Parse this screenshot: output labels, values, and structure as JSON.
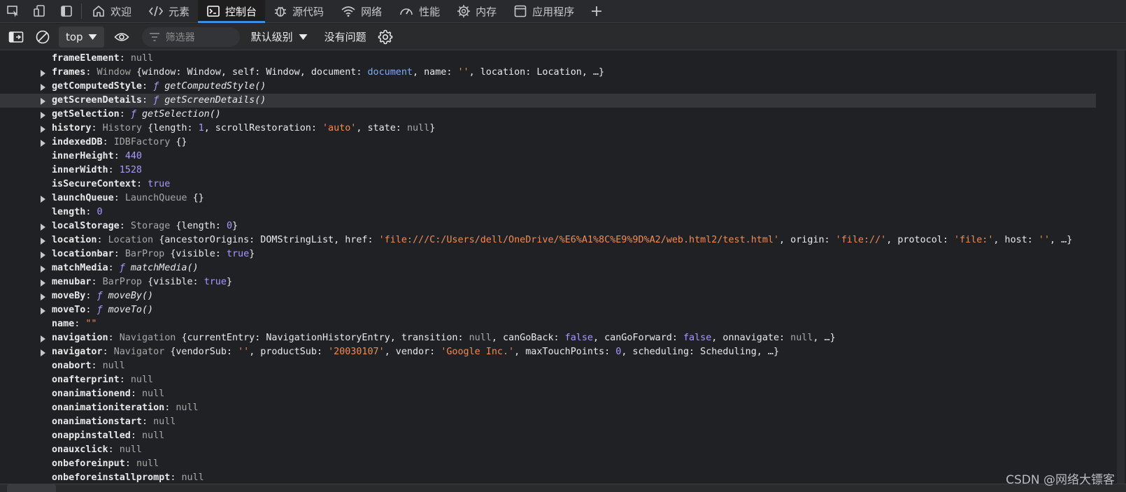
{
  "tabs": [
    {
      "label": "欢迎",
      "icon": "home-icon",
      "active": false
    },
    {
      "label": "元素",
      "icon": "code-icon",
      "active": false
    },
    {
      "label": "控制台",
      "icon": "console-icon",
      "active": true
    },
    {
      "label": "源代码",
      "icon": "bug-icon",
      "active": false
    },
    {
      "label": "网络",
      "icon": "wifi-icon",
      "active": false
    },
    {
      "label": "性能",
      "icon": "gauge-icon",
      "active": false
    },
    {
      "label": "内存",
      "icon": "memory-chip-icon",
      "active": false
    },
    {
      "label": "应用程序",
      "icon": "window-icon",
      "active": false
    }
  ],
  "toolbar": {
    "context": "top",
    "filter_placeholder": "筛选器",
    "level": "默认级别",
    "issues": "没有问题"
  },
  "console_rows": [
    {
      "arrow": false,
      "key": "frameElement",
      "parts": [
        [
          "g",
          "null"
        ]
      ]
    },
    {
      "arrow": true,
      "key": "frames",
      "parts": [
        [
          "g",
          "Window "
        ],
        [
          "t",
          "{window: Window, self: Window, document: "
        ],
        [
          "lnk",
          "document"
        ],
        [
          "t",
          ", name: "
        ],
        [
          "s",
          "''"
        ],
        [
          "t",
          ", location: Location, …}"
        ]
      ]
    },
    {
      "arrow": true,
      "key": "getComputedStyle",
      "parts": [
        [
          "fn",
          "ƒ "
        ],
        [
          "fnn",
          "getComputedStyle()"
        ]
      ]
    },
    {
      "arrow": true,
      "key": "getScreenDetails",
      "hl": true,
      "parts": [
        [
          "fn",
          "ƒ "
        ],
        [
          "fnn",
          "getScreenDetails()"
        ]
      ]
    },
    {
      "arrow": true,
      "key": "getSelection",
      "parts": [
        [
          "fn",
          "ƒ "
        ],
        [
          "fnn",
          "getSelection()"
        ]
      ]
    },
    {
      "arrow": true,
      "key": "history",
      "parts": [
        [
          "g",
          "History "
        ],
        [
          "t",
          "{length: "
        ],
        [
          "n",
          "1"
        ],
        [
          "t",
          ", scrollRestoration: "
        ],
        [
          "s",
          "'auto'"
        ],
        [
          "t",
          ", state: "
        ],
        [
          "g",
          "null"
        ],
        [
          "t",
          "}"
        ]
      ]
    },
    {
      "arrow": true,
      "key": "indexedDB",
      "parts": [
        [
          "g",
          "IDBFactory "
        ],
        [
          "t",
          "{}"
        ]
      ]
    },
    {
      "arrow": false,
      "key": "innerHeight",
      "parts": [
        [
          "n",
          "440"
        ]
      ]
    },
    {
      "arrow": false,
      "key": "innerWidth",
      "parts": [
        [
          "n",
          "1528"
        ]
      ]
    },
    {
      "arrow": false,
      "key": "isSecureContext",
      "parts": [
        [
          "kw",
          "true"
        ]
      ]
    },
    {
      "arrow": true,
      "key": "launchQueue",
      "parts": [
        [
          "g",
          "LaunchQueue "
        ],
        [
          "t",
          "{}"
        ]
      ]
    },
    {
      "arrow": false,
      "key": "length",
      "parts": [
        [
          "n",
          "0"
        ]
      ]
    },
    {
      "arrow": true,
      "key": "localStorage",
      "parts": [
        [
          "g",
          "Storage "
        ],
        [
          "t",
          "{length: "
        ],
        [
          "n",
          "0"
        ],
        [
          "t",
          "}"
        ]
      ]
    },
    {
      "arrow": true,
      "key": "location",
      "parts": [
        [
          "g",
          "Location "
        ],
        [
          "t",
          "{ancestorOrigins: DOMStringList, href: "
        ],
        [
          "s",
          "'file:///C:/Users/dell/OneDrive/%E6%A1%8C%E9%9D%A2/web.html2/test.html'"
        ],
        [
          "t",
          ", origin: "
        ],
        [
          "s",
          "'file://'"
        ],
        [
          "t",
          ", protocol: "
        ],
        [
          "s",
          "'file:'"
        ],
        [
          "t",
          ", host: "
        ],
        [
          "s",
          "''"
        ],
        [
          "t",
          ", …}"
        ]
      ]
    },
    {
      "arrow": true,
      "key": "locationbar",
      "parts": [
        [
          "g",
          "BarProp "
        ],
        [
          "t",
          "{visible: "
        ],
        [
          "kw",
          "true"
        ],
        [
          "t",
          "}"
        ]
      ]
    },
    {
      "arrow": true,
      "key": "matchMedia",
      "parts": [
        [
          "fn",
          "ƒ "
        ],
        [
          "fnn",
          "matchMedia()"
        ]
      ]
    },
    {
      "arrow": true,
      "key": "menubar",
      "parts": [
        [
          "g",
          "BarProp "
        ],
        [
          "t",
          "{visible: "
        ],
        [
          "kw",
          "true"
        ],
        [
          "t",
          "}"
        ]
      ]
    },
    {
      "arrow": true,
      "key": "moveBy",
      "parts": [
        [
          "fn",
          "ƒ "
        ],
        [
          "fnn",
          "moveBy()"
        ]
      ]
    },
    {
      "arrow": true,
      "key": "moveTo",
      "parts": [
        [
          "fn",
          "ƒ "
        ],
        [
          "fnn",
          "moveTo()"
        ]
      ]
    },
    {
      "arrow": false,
      "key": "name",
      "parts": [
        [
          "s",
          "\"\""
        ]
      ]
    },
    {
      "arrow": true,
      "key": "navigation",
      "parts": [
        [
          "g",
          "Navigation "
        ],
        [
          "t",
          "{currentEntry: NavigationHistoryEntry, transition: "
        ],
        [
          "g",
          "null"
        ],
        [
          "t",
          ", canGoBack: "
        ],
        [
          "kw",
          "false"
        ],
        [
          "t",
          ", canGoForward: "
        ],
        [
          "kw",
          "false"
        ],
        [
          "t",
          ", onnavigate: "
        ],
        [
          "g",
          "null"
        ],
        [
          "t",
          ", …}"
        ]
      ]
    },
    {
      "arrow": true,
      "key": "navigator",
      "parts": [
        [
          "g",
          "Navigator "
        ],
        [
          "t",
          "{vendorSub: "
        ],
        [
          "s",
          "''"
        ],
        [
          "t",
          ", productSub: "
        ],
        [
          "s",
          "'20030107'"
        ],
        [
          "t",
          ", vendor: "
        ],
        [
          "s",
          "'Google Inc.'"
        ],
        [
          "t",
          ", maxTouchPoints: "
        ],
        [
          "n",
          "0"
        ],
        [
          "t",
          ", scheduling: Scheduling, …}"
        ]
      ]
    },
    {
      "arrow": false,
      "key": "onabort",
      "parts": [
        [
          "g",
          "null"
        ]
      ]
    },
    {
      "arrow": false,
      "key": "onafterprint",
      "parts": [
        [
          "g",
          "null"
        ]
      ]
    },
    {
      "arrow": false,
      "key": "onanimationend",
      "parts": [
        [
          "g",
          "null"
        ]
      ]
    },
    {
      "arrow": false,
      "key": "onanimationiteration",
      "parts": [
        [
          "g",
          "null"
        ]
      ]
    },
    {
      "arrow": false,
      "key": "onanimationstart",
      "parts": [
        [
          "g",
          "null"
        ]
      ]
    },
    {
      "arrow": false,
      "key": "onappinstalled",
      "parts": [
        [
          "g",
          "null"
        ]
      ]
    },
    {
      "arrow": false,
      "key": "onauxclick",
      "parts": [
        [
          "g",
          "null"
        ]
      ]
    },
    {
      "arrow": false,
      "key": "onbeforeinput",
      "parts": [
        [
          "g",
          "null"
        ]
      ]
    },
    {
      "arrow": false,
      "key": "onbeforeinstallprompt",
      "parts": [
        [
          "g",
          "null"
        ]
      ]
    }
  ],
  "watermark": "CSDN @网络大镖客"
}
